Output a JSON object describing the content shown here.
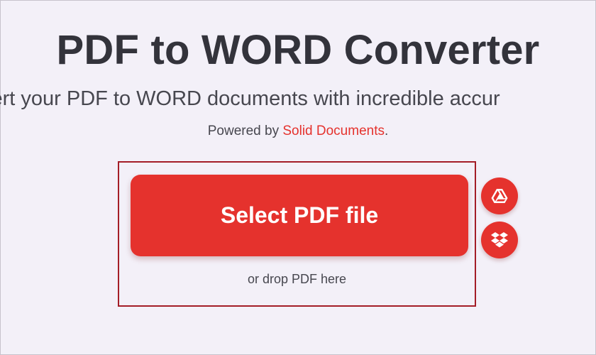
{
  "header": {
    "title": "PDF to WORD Converter",
    "subtitle": "vert your PDF to WORD documents with incredible accur",
    "powered_prefix": "Powered by ",
    "powered_link": "Solid Documents",
    "powered_suffix": "."
  },
  "upload": {
    "select_label": "Select PDF file",
    "drop_label": "or drop PDF here"
  },
  "cloud_buttons": [
    {
      "icon": "google-drive-icon"
    },
    {
      "icon": "dropbox-icon"
    }
  ],
  "colors": {
    "accent": "#e5322d",
    "highlight_border": "#a31d27",
    "background": "#f3f0f8"
  }
}
